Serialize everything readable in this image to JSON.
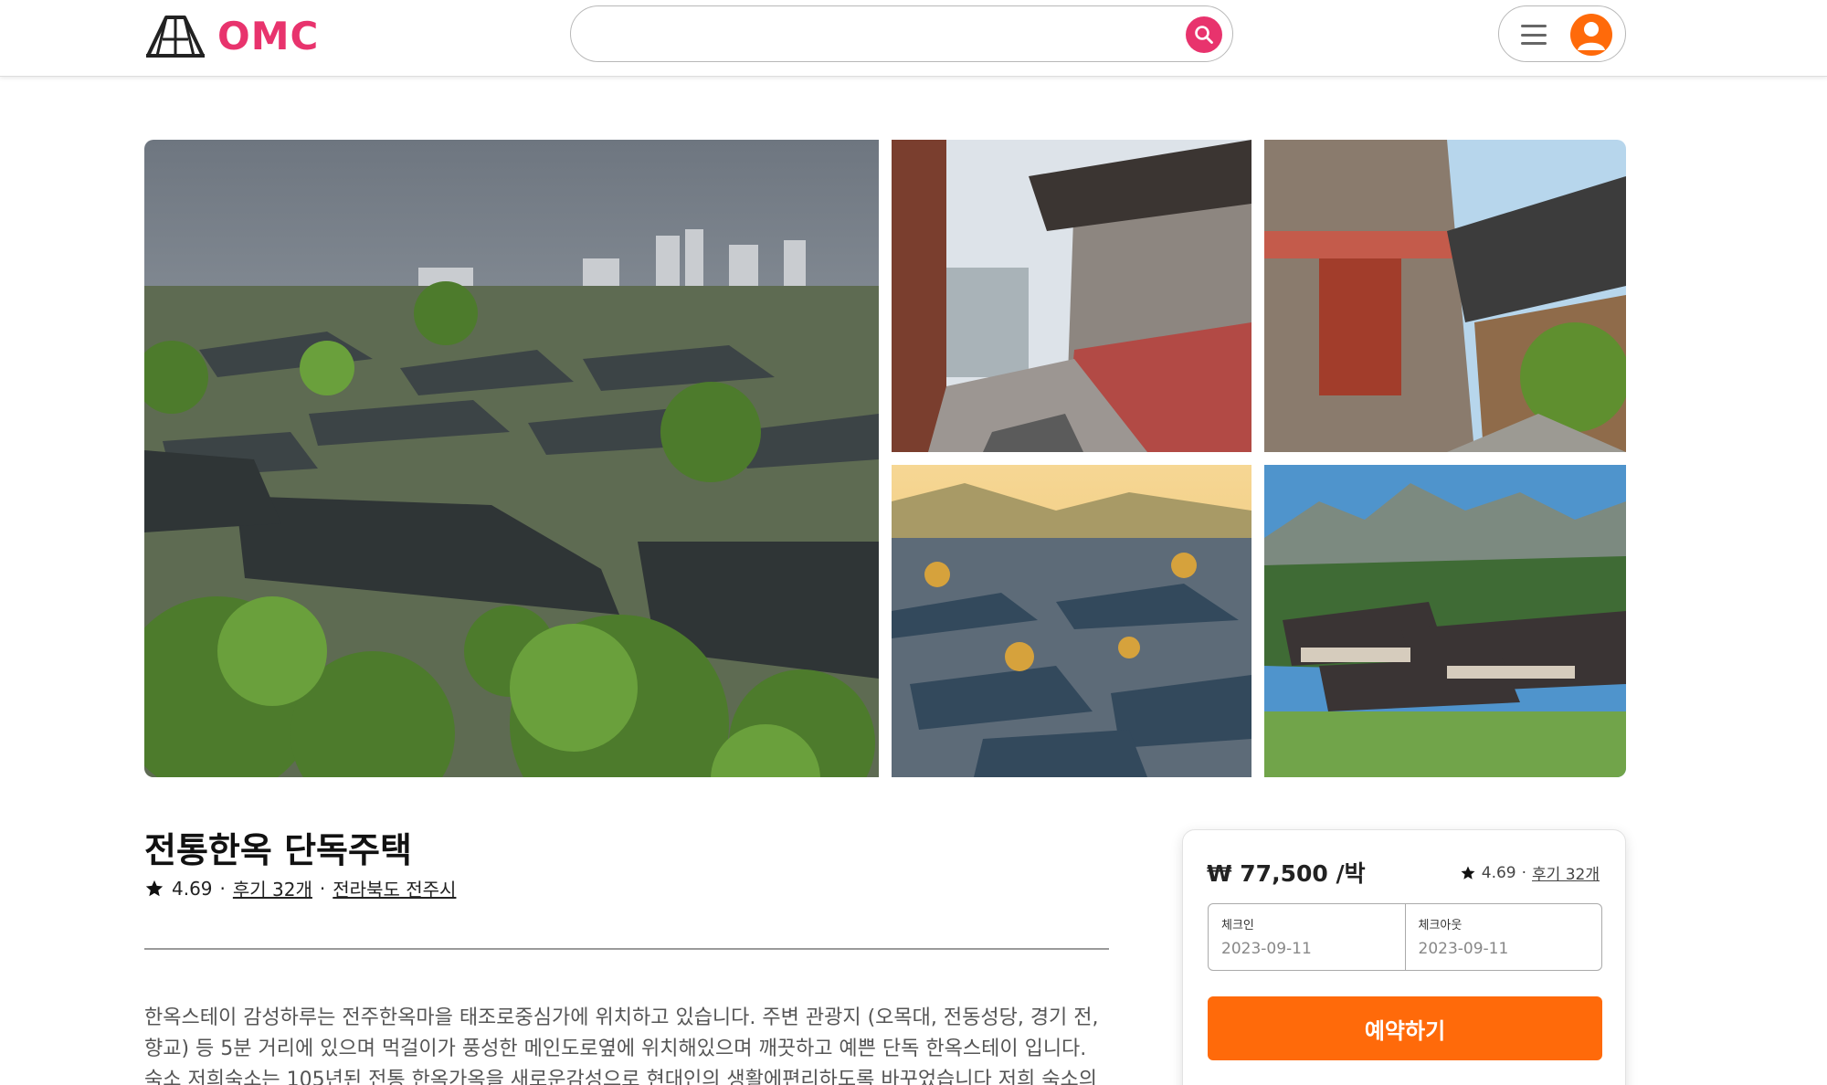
{
  "brand": {
    "name": "OMC",
    "color": "#e8336d"
  },
  "search": {
    "placeholder": "",
    "value": ""
  },
  "header": {
    "menu_icon": "hamburger-icon",
    "avatar_icon": "user-avatar-icon"
  },
  "gallery": {
    "photos": [
      {
        "name": "photo-main-hanok-village"
      },
      {
        "name": "photo-hanok-alley"
      },
      {
        "name": "photo-hanok-gate"
      },
      {
        "name": "photo-hanok-sunset"
      },
      {
        "name": "photo-hanok-mountains"
      }
    ]
  },
  "listing": {
    "title": "전통한옥 단독주택",
    "rating": "4.69",
    "separator": "·",
    "reviews": "후기 32개",
    "location": "전라북도 전주시",
    "description": "한옥스테이 감성하루는 전주한옥마을 태조로중심가에 위치하고 있습니다. 주변 관광지 (오목대, 전동성당, 경기 전, 향교) 등 5분 거리에 있으며 먹걸이가 풍성한 메인도로옆에 위치해있으며 깨끗하고 예쁜 단독 한옥스테이 입니다. 숙소 저희숙소는 105년된 전통 한옥가옥을 새로운감성으로 현대인의 생활에편리하도록 바꾸었습니다 저희 숙소의 장"
  },
  "booking": {
    "price": "₩ 77,500 /박",
    "rating": "4.69",
    "separator": "·",
    "reviews": "후기 32개",
    "checkin_label": "체크인",
    "checkin_value": "2023-09-11",
    "checkout_label": "체크아웃",
    "checkout_value": "2023-09-11",
    "reserve_label": "예약하기",
    "accent": "#ff6a0a"
  }
}
